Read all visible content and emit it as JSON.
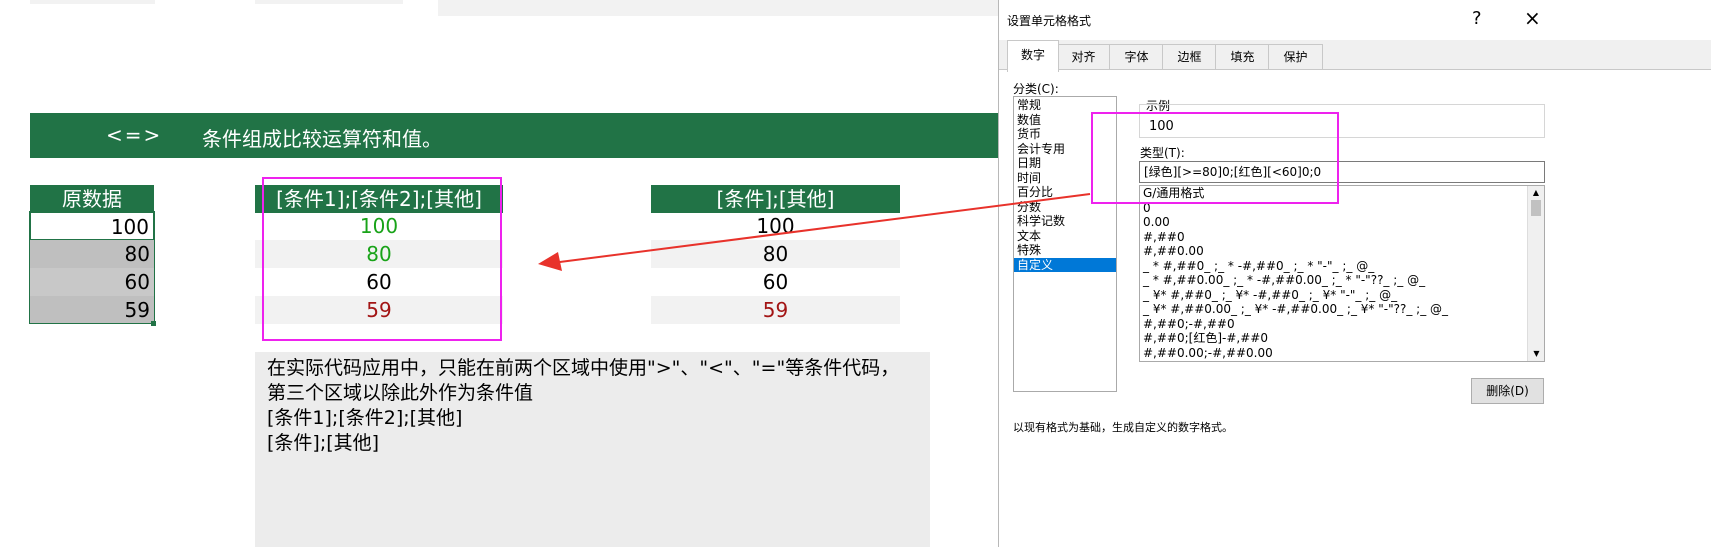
{
  "banner": {
    "operator": "<=>",
    "text": "条件组成比较运算符和值。"
  },
  "table1": {
    "header": "原数据",
    "values": [
      "100",
      "80",
      "60",
      "59"
    ]
  },
  "table2": {
    "header": "[条件1];[条件2];[其他]",
    "values": [
      "100",
      "80",
      "60",
      "59"
    ],
    "colors": [
      "#19a319",
      "#19a319",
      "#000000",
      "#a31515"
    ]
  },
  "table3": {
    "header": "[条件];[其他]",
    "values": [
      "100",
      "80",
      "60",
      "59"
    ],
    "colors": [
      "#000000",
      "#000000",
      "#000000",
      "#a31515"
    ]
  },
  "note": {
    "line1": "在实际代码应用中，只能在前两个区域中使用\">\"、\"<\"、\"=\"等条件代码，",
    "line2": "第三个区域以除此外作为条件值",
    "line3": "[条件1];[条件2];[其他]",
    "line4": "[条件];[其他]"
  },
  "dialog": {
    "title": "设置单元格格式",
    "help": "?",
    "close": "×",
    "tabs": [
      "数字",
      "对齐",
      "字体",
      "边框",
      "填充",
      "保护"
    ],
    "category_label": "分类(C):",
    "categories": [
      "常规",
      "数值",
      "货币",
      "会计专用",
      "日期",
      "时间",
      "百分比",
      "分数",
      "科学记数",
      "文本",
      "特殊",
      "自定义"
    ],
    "selected_category": "自定义",
    "sample_label": "示例",
    "sample_value": "100",
    "type_label": "类型(T):",
    "type_value": "[绿色][>=80]0;[红色][<60]0;0",
    "formats": [
      "G/通用格式",
      "0",
      "0.00",
      "#,##0",
      "#,##0.00",
      "_ * #,##0_ ;_ * -#,##0_ ;_ * \"-\"_ ;_ @_",
      "_ * #,##0.00_ ;_ * -#,##0.00_ ;_ * \"-\"??_ ;_ @_",
      "_ ¥* #,##0_ ;_ ¥* -#,##0_ ;_ ¥* \"-\"_ ;_ @_",
      "_ ¥* #,##0.00_ ;_ ¥* -#,##0.00_ ;_ ¥* \"-\"??_ ;_ @_",
      "#,##0;-#,##0",
      "#,##0;[红色]-#,##0",
      "#,##0.00;-#,##0.00"
    ],
    "delete_button": "删除(D)",
    "description": "以现有格式为基础，生成自定义的数字格式。"
  },
  "colors": {
    "excel_green": "#217346",
    "highlight": "#ee22ee",
    "arrow": "#e8322b",
    "selection": "#0078d7"
  }
}
